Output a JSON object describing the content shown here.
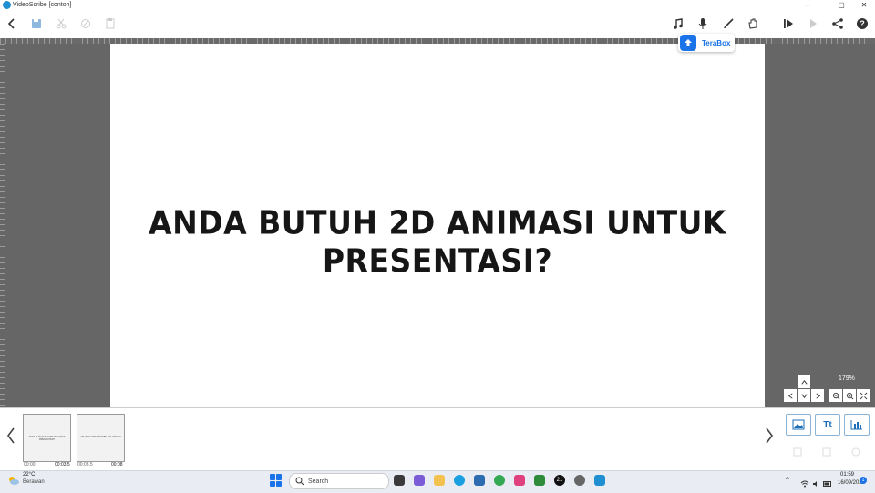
{
  "window": {
    "title": "VideoScribe [contoh]",
    "minimize": "–",
    "maximize": "▢",
    "close": "✕"
  },
  "toolbar": {
    "icons": [
      "back-icon",
      "save-icon",
      "cut-icon",
      "copy-icon",
      "paste-icon",
      "music-icon",
      "microphone-icon",
      "brush-icon",
      "hand-icon",
      "play-from-icon",
      "play-icon",
      "share-icon",
      "help-icon"
    ]
  },
  "canvas": {
    "headline": "ANDA BUTUH 2D ANIMASI UNTUK PRESENTASI?"
  },
  "terabox": {
    "label": "TeraBox"
  },
  "zoom": {
    "level": "179%"
  },
  "filmstrip": {
    "thumbs": [
      {
        "text": "ANDA BUTUH 2D ANIMASI UNTUK PRESENTASI?",
        "start": "00:00",
        "end": "00:03.5"
      },
      {
        "text": "APLIKASI VIDEOSCRIBE SOLUSINYA!",
        "start": "00:03.5",
        "end": "00:08"
      }
    ],
    "add_image_icon": "image-icon",
    "add_text_label": "Tt",
    "add_chart_icon": "chart-icon"
  },
  "taskbar": {
    "temperature": "22°C",
    "condition": "Berawan",
    "search_label": "Search",
    "tray_number": "21",
    "time": "01:59",
    "date": "16/09/2023",
    "notifications": "1"
  },
  "colors": {
    "workspace": "#666666",
    "accent": "#1a73e8"
  }
}
